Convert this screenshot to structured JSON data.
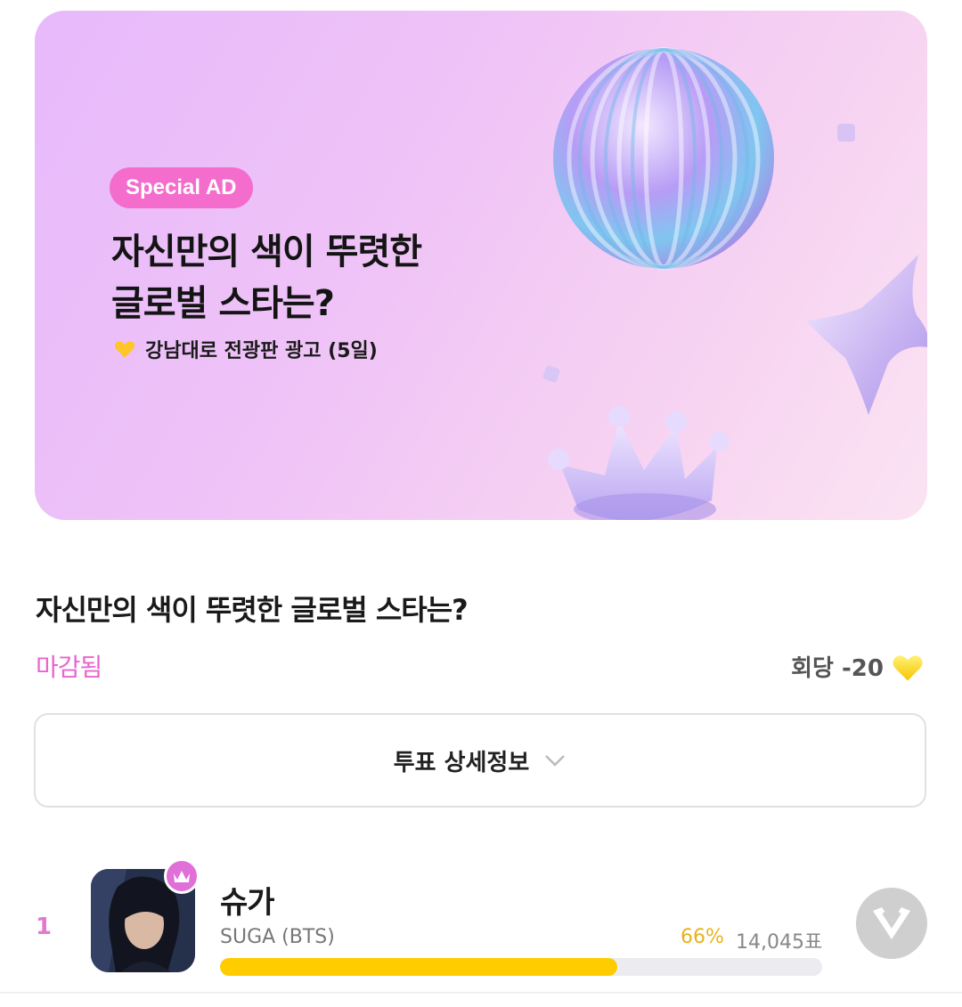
{
  "banner": {
    "badge": "Special AD",
    "title_line1": "자신만의 색이 뚜렷한",
    "title_line2": "글로벌 스타는?",
    "subtitle": "강남대로 전광판 광고 (5일)"
  },
  "poll": {
    "title": "자신만의 색이 뚜렷한 글로벌 스타는?",
    "status": "마감됨",
    "cost_label": "회당 -20",
    "details_label": "투표 상세정보"
  },
  "ranking": [
    {
      "rank": "1",
      "name": "슈가",
      "sub_name": "SUGA (BTS)",
      "percent": "66%",
      "votes": "14,045표",
      "progress": 0.66
    }
  ],
  "colors": {
    "accent_pink": "#ea65cf",
    "badge_pink": "#f46ccc",
    "progress_yellow": "#ffcc00",
    "percent_gold": "#e8b21e"
  }
}
